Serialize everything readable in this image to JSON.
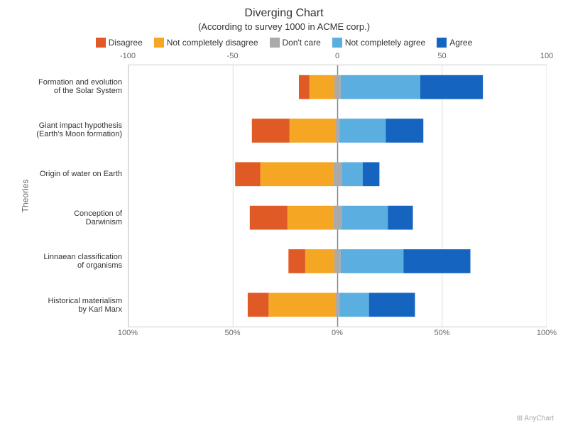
{
  "title": "Diverging Chart",
  "subtitle": "(According to survey 1000 in ACME corp.)",
  "legend": [
    {
      "label": "Disagree",
      "color": "#e05a26"
    },
    {
      "label": "Not completely disagree",
      "color": "#f5a623"
    },
    {
      "label": "Don't care",
      "color": "#aaa"
    },
    {
      "label": "Not completely agree",
      "color": "#5aaee0"
    },
    {
      "label": "Agree",
      "color": "#1565c0"
    }
  ],
  "y_axis_label": "Theories",
  "categories": [
    "Formation and evolution\nof the Solar System",
    "Giant impact hypothesis\n(Earth's Moon formation)",
    "Origin of water on Earth",
    "Conception of Darwinism",
    "Linnaean classification\nof organisms",
    "Historical materialism\nby Karl Marx"
  ],
  "top_axis": [
    "-100",
    "-50",
    "0",
    "50",
    "100"
  ],
  "bottom_axis": [
    "100%",
    "50%",
    "0%",
    "50%",
    "100%"
  ],
  "bars": [
    {
      "disagree": 5,
      "not_dis": 12,
      "dont_care": 3,
      "not_agree": 38,
      "agree": 30
    },
    {
      "disagree": 18,
      "not_dis": 22,
      "dont_care": 2,
      "not_agree": 22,
      "agree": 18
    },
    {
      "disagree": 12,
      "not_dis": 35,
      "dont_care": 4,
      "not_agree": 10,
      "agree": 8
    },
    {
      "disagree": 18,
      "not_dis": 22,
      "dont_care": 4,
      "not_agree": 22,
      "agree": 12
    },
    {
      "disagree": 8,
      "not_dis": 14,
      "dont_care": 3,
      "not_agree": 30,
      "agree": 32
    },
    {
      "disagree": 10,
      "not_dis": 32,
      "dont_care": 2,
      "not_agree": 14,
      "agree": 22
    }
  ],
  "colors": {
    "disagree": "#e05a26",
    "not_disagree": "#f5a623",
    "dont_care": "#aaaaaa",
    "not_agree": "#5aaee0",
    "agree": "#1565c0"
  }
}
